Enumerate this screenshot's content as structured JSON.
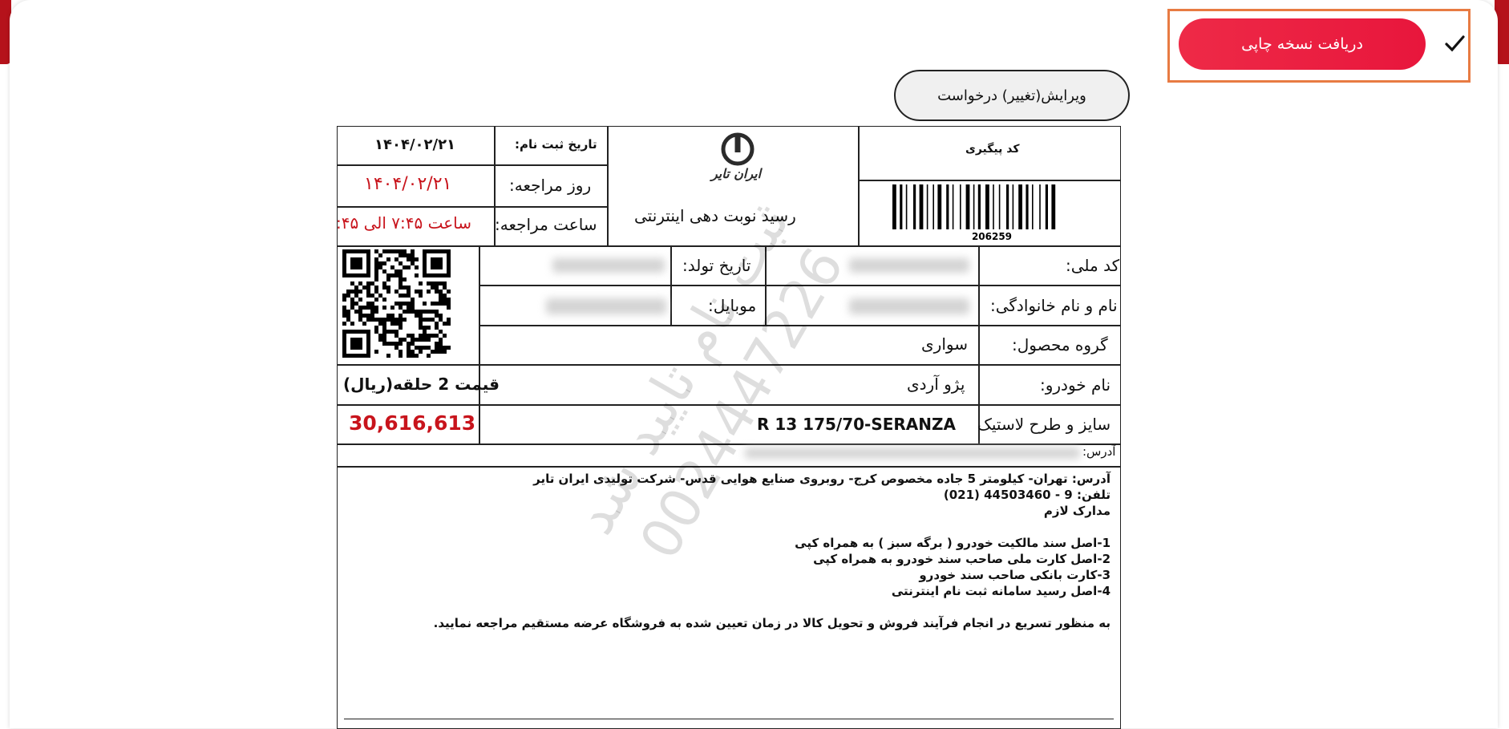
{
  "actions": {
    "print_label": "دریافت نسخه چاپی",
    "edit_label": "ویرایش(تغییر) درخواست"
  },
  "receipt": {
    "reg_date_label": "تاریخ ثبت نام:",
    "reg_date": "۱۴۰۴/۰۲/۲۱",
    "visit_day_label": "روز مراجعه:",
    "visit_day": "۱۴۰۴/۰۲/۲۱",
    "visit_time_label": "ساعت مراجعه:",
    "visit_time": "ساعت ۷:۴۵ الی ۴۵:",
    "logo_text": "ایران تایر",
    "title": "رسید نوبت دهی اینترنتی",
    "tracking_label": "کد پیگیری",
    "barcode_number": "206259",
    "national_code_label": "کد ملی:",
    "birth_date_label": "تاریخ تولد:",
    "full_name_label": "نام و نام خانوادگی:",
    "mobile_label": "موبایل:",
    "product_group_label": "گروه محصول:",
    "product_group": "سواری",
    "car_name_label": "نام خودرو:",
    "car_name": "پژو آردی",
    "tire_label": "سایز و طرح لاستیک",
    "tire_value": "R 13 175/70-SERANZA",
    "price_label": "قیمت 2 حلقه(ریال)",
    "price": "30,616,613",
    "address_label": "آدرس:",
    "notes": [
      "آدرس: تهران- کیلومتر 5 جاده مخصوص کرج- روبروی صنایع هوایی قدس- شرکت تولیدی ایران تایر",
      "تلفن: 9 - 44503460 (021)",
      "مدارک لازم",
      "",
      "1-اصل سند مالکیت خودرو ( برگه سبز ) به همراه کپی",
      "2-اصل کارت ملی صاحب سند خودرو به همراه کپی",
      "3-کارت بانکی صاحب سند خودرو",
      "4-اصل رسید سامانه ثبت نام اینترنتی",
      "",
      "به منظور تسریع در انجام فرآیند فروش و تحویل کالا در زمان تعیین شده به فروشگاه عرضه مستقیم مراجعه نمایید."
    ],
    "watermark_line1": "ثبت نام تایید شد",
    "watermark_line2": "0024447226"
  },
  "colors": {
    "accent": "#ee2a47",
    "highlight_border": "#e87b43",
    "red_text": "#c8141c"
  }
}
